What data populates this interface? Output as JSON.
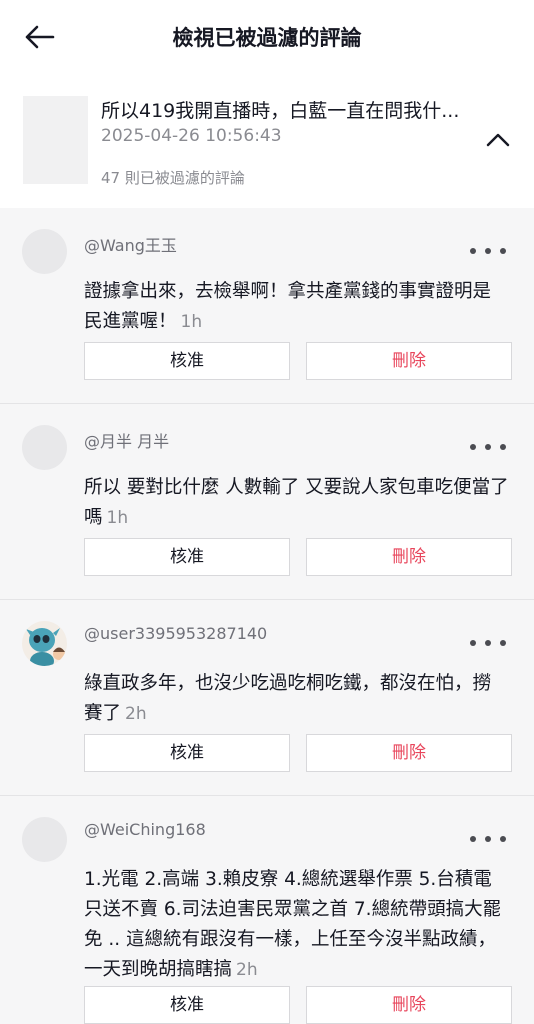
{
  "header": {
    "title": "檢視已被過濾的評論"
  },
  "video": {
    "caption": "所以419我開直播時，白藍一直在問我什...",
    "date": "2025-04-26 10:56:43",
    "filtered_count": "47 則已被過濾的評論"
  },
  "actions": {
    "approve_label": "核准",
    "delete_label": "刪除"
  },
  "comments": [
    {
      "user": "@Wang王玉",
      "text": "證據拿出來，去檢舉啊！拿共產黨錢的事實證明是民進黨喔！",
      "time": "1h"
    },
    {
      "user": "@月半 月半",
      "text": "所以 要對比什麼 人數輸了 又要說人家包車吃便當了嗎",
      "time": "1h"
    },
    {
      "user": "@user3395953287140",
      "text": "綠直政多年，也沒少吃過吃桐吃鐵，都沒在怕，撈賽了",
      "time": "2h"
    },
    {
      "user": "@WeiChing168",
      "text": "1.光電 2.高端 3.賴皮寮 4.總統選舉作票 5.台積電只送不賣 6.司法迫害民眾黨之首 7.總統帶頭搞大罷免 .. 這總統有跟沒有一樣，上任至今沒半點政績，一天到晚胡搞瞎搞",
      "time": "2h"
    }
  ]
}
